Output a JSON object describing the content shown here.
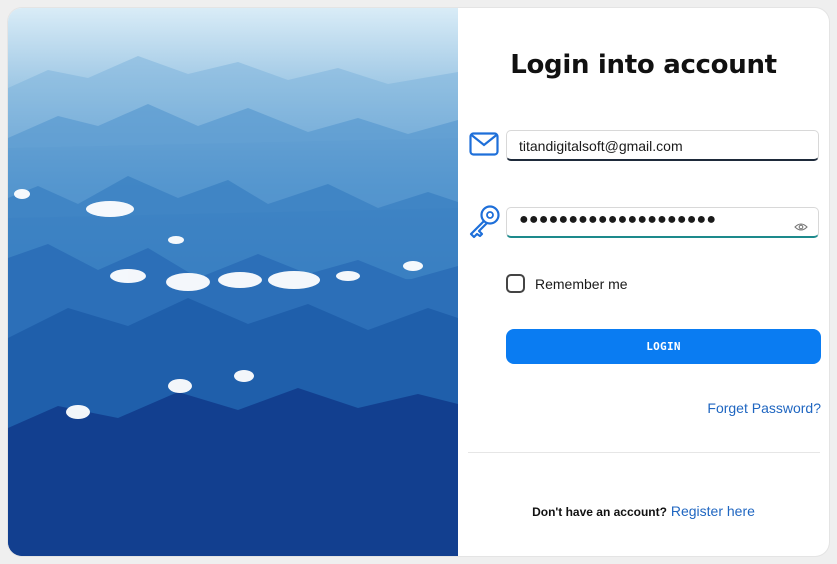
{
  "login": {
    "title": "Login into account",
    "email_value": "titandigitalsoft@gmail.com",
    "password_value": "●●●●●●●●●●●●●●●●●●●●",
    "remember_label": "Remember me",
    "remember_checked": false,
    "login_button": "LOGIN",
    "forgot_link": "Forget Password?",
    "no_account_text": "Don't have an account?",
    "register_link": "Register here"
  },
  "icons": {
    "email": "envelope-icon",
    "password": "key-icon",
    "reveal": "eye-icon"
  },
  "colors": {
    "accent": "#0a7cf2",
    "link": "#1f66c1",
    "icon": "#1e6fd9"
  }
}
